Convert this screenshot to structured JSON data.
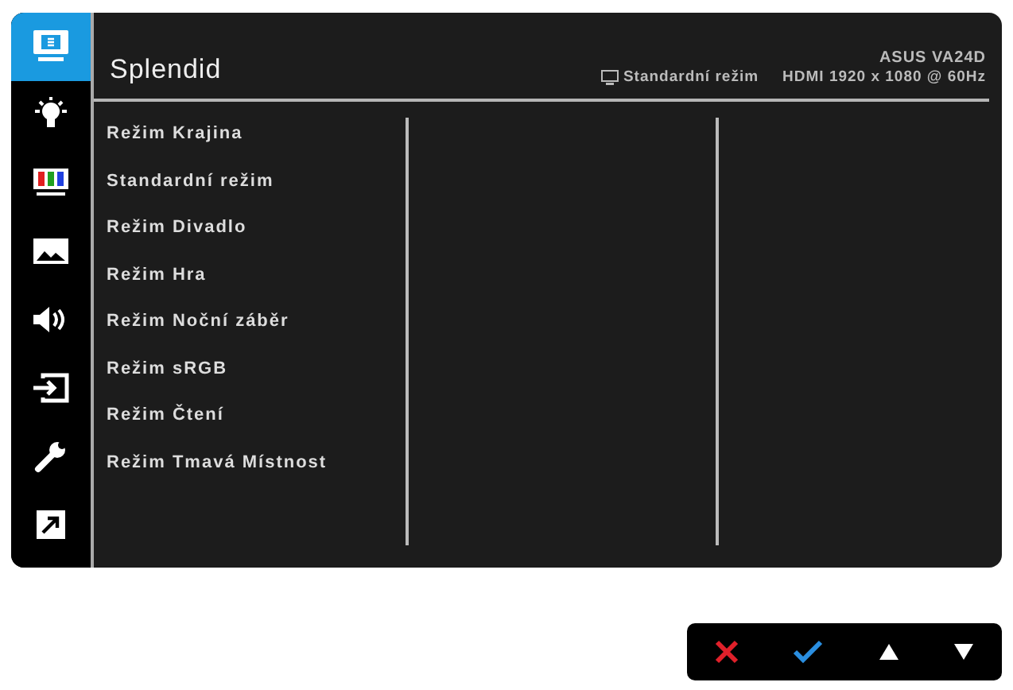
{
  "sidebar": {
    "items": [
      {
        "selected": true
      },
      {
        "selected": false
      },
      {
        "selected": false
      },
      {
        "selected": false
      },
      {
        "selected": false
      },
      {
        "selected": false
      },
      {
        "selected": false
      },
      {
        "selected": false
      }
    ]
  },
  "header": {
    "title": "Splendid",
    "model": "ASUS VA24D",
    "current_mode": "Standardní režim",
    "signal": "HDMI 1920 x 1080 @ 60Hz"
  },
  "menu": {
    "items": [
      "Režim Krajina",
      "Standardní režim",
      "Režim Divadlo",
      "Režim Hra",
      "Režim Noční záběr",
      "Režim sRGB",
      "Režim Čtení",
      "Režim Tmavá Místnost"
    ]
  },
  "keys": [
    {
      "kind": "close"
    },
    {
      "kind": "confirm"
    },
    {
      "kind": "up"
    },
    {
      "kind": "down"
    }
  ]
}
